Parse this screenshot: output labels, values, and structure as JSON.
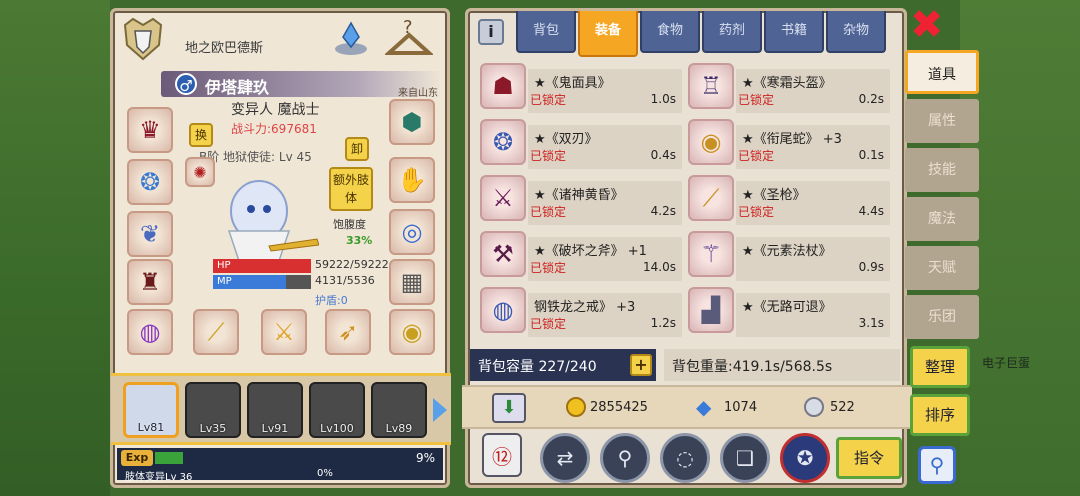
{
  "character": {
    "title": "地之欧巴德斯",
    "name": "伊塔肆玖",
    "gender_icon": "♂",
    "origin": "来自山东",
    "class": "变异人 魔战士",
    "power": "战斗力:697681",
    "rank": "B阶 地狱使徒: Lv 45",
    "swap_label": "换",
    "unload_label": "卸",
    "extra_limb_label": "额外肢体",
    "hunger_label": "饱腹度",
    "hunger_value": "33%",
    "hp": {
      "label": "HP",
      "value": "59222/59222",
      "fraction": 1.0
    },
    "mp": {
      "label": "MP",
      "value": "4131/5536",
      "fraction": 0.746
    },
    "shield": "护盾:0",
    "exp_label": "Exp",
    "exp_pct": "9%",
    "exp_fraction": 0.09,
    "skill_line": "肢体变异Lv 36",
    "skill_pct": "0%"
  },
  "team": [
    {
      "level": "Lv81",
      "active": true
    },
    {
      "level": "Lv35",
      "active": false
    },
    {
      "level": "Lv91",
      "active": false
    },
    {
      "level": "Lv100",
      "active": false
    },
    {
      "level": "Lv89",
      "active": false
    }
  ],
  "inventory": {
    "tabs": [
      "背包",
      "装备",
      "食物",
      "药剂",
      "书籍",
      "杂物"
    ],
    "active_tab": "装备",
    "items": [
      {
        "name": "★《鬼面具》",
        "lock": "已锁定",
        "weight": "1.0s",
        "icon": "mask-icon"
      },
      {
        "name": "★《寒霜头盔》",
        "lock": "已锁定",
        "weight": "0.2s",
        "icon": "helmet-icon"
      },
      {
        "name": "★《双刃》",
        "lock": "已锁定",
        "weight": "0.4s",
        "icon": "amulet-icon"
      },
      {
        "name": "★《衔尾蛇》 +3",
        "lock": "已锁定",
        "weight": "0.1s",
        "icon": "snake-ring-icon"
      },
      {
        "name": "★《诸神黄昏》",
        "lock": "已锁定",
        "weight": "4.2s",
        "icon": "sword-icon"
      },
      {
        "name": "★《圣枪》",
        "lock": "已锁定",
        "weight": "4.4s",
        "icon": "spear-icon"
      },
      {
        "name": "★《破坏之斧》 +1",
        "lock": "已锁定",
        "weight": "14.0s",
        "icon": "axe-icon"
      },
      {
        "name": "★《元素法杖》",
        "lock": "",
        "weight": "0.9s",
        "icon": "staff-icon"
      },
      {
        "name": "钢铁龙之戒》 +3",
        "lock": "已锁定",
        "weight": "1.2s",
        "icon": "ring-icon"
      },
      {
        "name": "★《无路可退》",
        "lock": "",
        "weight": "3.1s",
        "icon": "boots-icon"
      }
    ],
    "capacity": "背包容量 227/240",
    "weight": "背包重量:419.1s/568.5s",
    "gold": "2855425",
    "diamond": "1074",
    "silver": "522",
    "command_label": "指令"
  },
  "side_nav": {
    "tabs": [
      "道具",
      "属性",
      "技能",
      "魔法",
      "天赋",
      "乐团"
    ],
    "active": "道具",
    "sort_label": "整理",
    "order_label": "排序",
    "bg_label": "电子巨蛋"
  }
}
